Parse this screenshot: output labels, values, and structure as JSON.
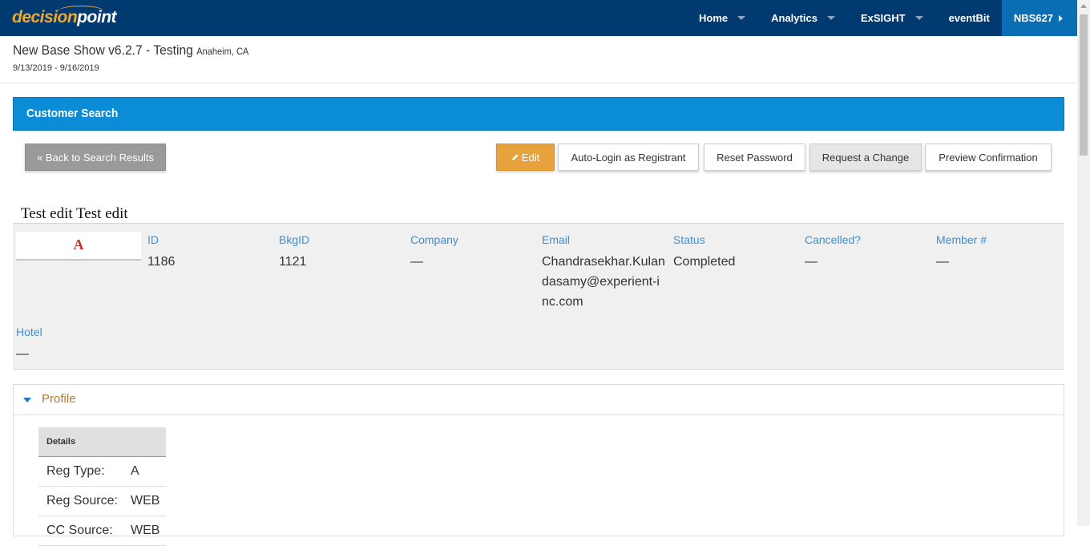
{
  "brand": {
    "part1": "decision",
    "part2": "point"
  },
  "nav": {
    "items": [
      {
        "label": "Home",
        "dropdown": true
      },
      {
        "label": "Analytics",
        "dropdown": true
      },
      {
        "label": "ExSIGHT",
        "dropdown": true
      },
      {
        "label": "eventBit",
        "dropdown": false
      }
    ],
    "account": "NBS627"
  },
  "show": {
    "title": "New Base Show v6.2.7 - Testing",
    "location": "Anaheim, CA",
    "dates": "9/13/2019 - 9/16/2019"
  },
  "section": {
    "title": "Customer Search"
  },
  "actions": {
    "back": "« Back to Search Results",
    "edit": "Edit",
    "auto_login": "Auto-Login as Registrant",
    "reset_password": "Reset Password",
    "request_change": "Request a Change",
    "preview_confirmation": "Preview Confirmation"
  },
  "registrant": {
    "name": "Test edit Test edit",
    "badge": "A",
    "fields": {
      "id": {
        "label": "ID",
        "value": "1186"
      },
      "bkgid": {
        "label": "BkgID",
        "value": "1121"
      },
      "company": {
        "label": "Company",
        "value": "—"
      },
      "email": {
        "label": "Email",
        "value": "Chandrasekhar.Kulandasamy@experient-inc.com"
      },
      "status": {
        "label": "Status",
        "value": "Completed"
      },
      "cancelled": {
        "label": "Cancelled?",
        "value": "—"
      },
      "member": {
        "label": "Member #",
        "value": "—"
      },
      "hotel": {
        "label": "Hotel",
        "value": "—"
      }
    }
  },
  "profile": {
    "title": "Profile",
    "details_header": "Details",
    "rows": [
      {
        "key": "Reg Type:",
        "value": "A"
      },
      {
        "key": "Reg Source:",
        "value": "WEB"
      },
      {
        "key": "CC Source:",
        "value": "WEB"
      }
    ]
  },
  "colors": {
    "topbar": "#003a70",
    "accent_blue": "#0a8dd6",
    "edit_orange": "#e8a23b",
    "label_blue": "#3b8fd4",
    "profile_title": "#b8762f"
  }
}
